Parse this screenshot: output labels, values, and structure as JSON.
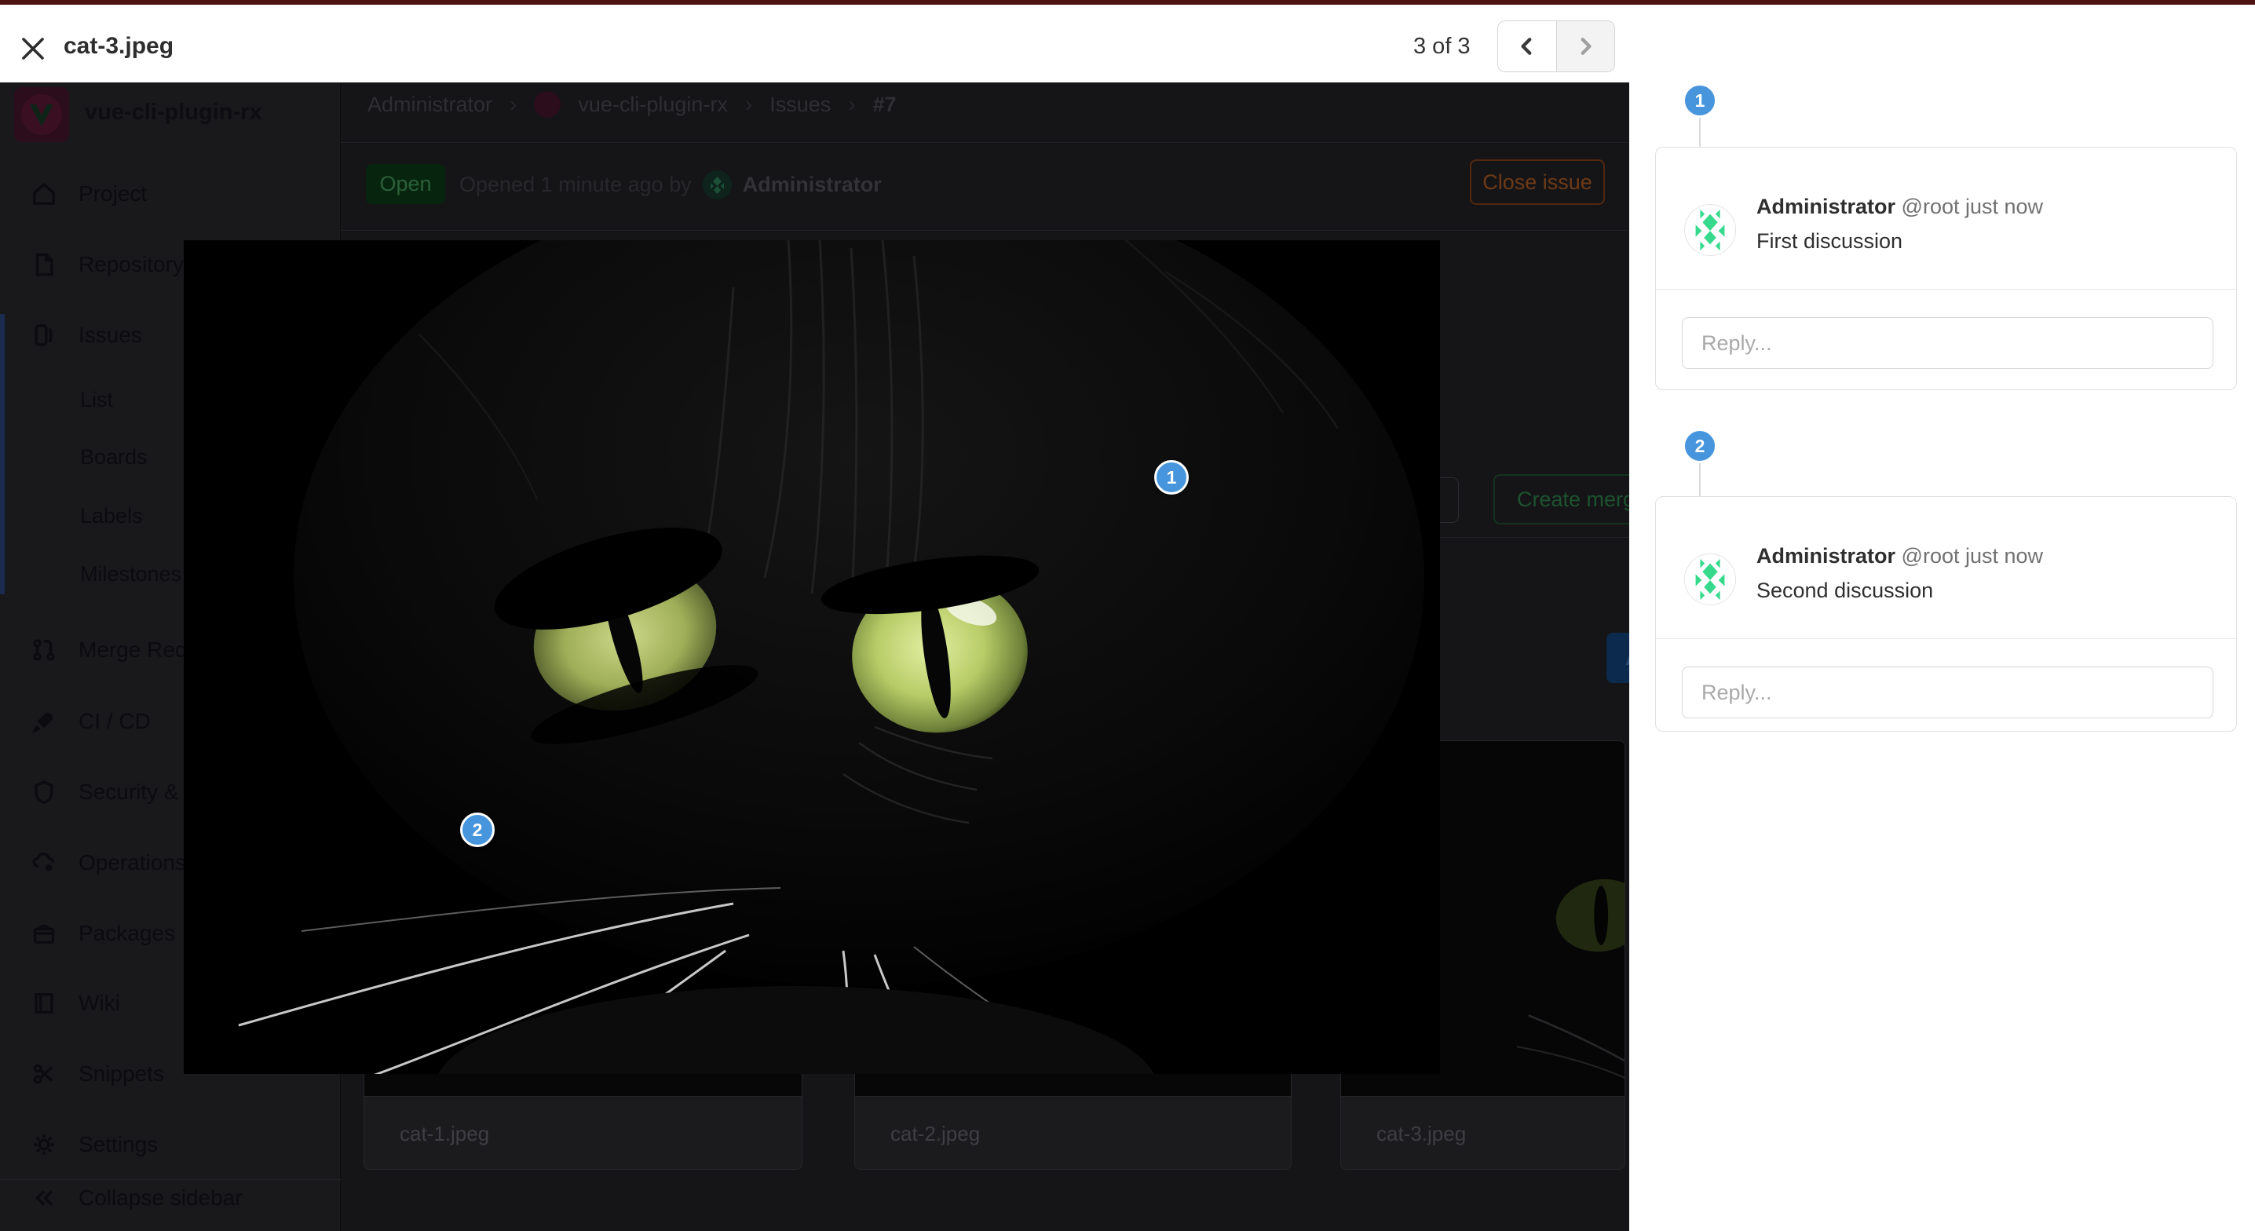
{
  "topbar": {
    "title": "cat-3.jpeg",
    "counter": "3 of 3"
  },
  "sidebar": {
    "project_name": "vue-cli-plugin-rx",
    "items": [
      {
        "icon": "home-icon",
        "label": "Project"
      },
      {
        "icon": "document-icon",
        "label": "Repository"
      },
      {
        "icon": "issues-icon",
        "label": "Issues"
      },
      {
        "icon": "",
        "label": "List"
      },
      {
        "icon": "",
        "label": "Boards"
      },
      {
        "icon": "",
        "label": "Labels"
      },
      {
        "icon": "",
        "label": "Milestones"
      },
      {
        "icon": "merge-request-icon",
        "label": "Merge Requests"
      },
      {
        "icon": "rocket-icon",
        "label": "CI / CD"
      },
      {
        "icon": "shield-icon",
        "label": "Security & Compliance"
      },
      {
        "icon": "cloud-gear-icon",
        "label": "Operations"
      },
      {
        "icon": "package-icon",
        "label": "Packages"
      },
      {
        "icon": "book-icon",
        "label": "Wiki"
      },
      {
        "icon": "scissors-icon",
        "label": "Snippets"
      },
      {
        "icon": "gear-icon",
        "label": "Settings"
      }
    ],
    "collapse_label": "Collapse sidebar"
  },
  "breadcrumb": {
    "items": [
      "Administrator",
      "vue-cli-plugin-rx",
      "Issues",
      "#7"
    ],
    "separator": "›"
  },
  "issue_header": {
    "status_badge": "Open",
    "opened_text": "Opened 1 minute ago by",
    "author": "Administrator",
    "close_button": "Close issue",
    "create_merge_button": "Create merge request",
    "comment_button": "A"
  },
  "designs": [
    {
      "filename": "cat-1.jpeg"
    },
    {
      "filename": "cat-2.jpeg"
    },
    {
      "filename": "cat-3.jpeg"
    }
  ],
  "discussions": [
    {
      "badge": "1",
      "author": "Administrator",
      "meta": "@root just now",
      "body": "First discussion",
      "reply_placeholder": "Reply..."
    },
    {
      "badge": "2",
      "author": "Administrator",
      "meta": "@root just now",
      "body": "Second discussion",
      "reply_placeholder": "Reply..."
    }
  ],
  "image_pins": [
    {
      "number": "1"
    },
    {
      "number": "2"
    }
  ],
  "colors": {
    "pin_blue": "#4795dc",
    "top_bar": "#4e1212",
    "open_badge_green": "#07240f"
  }
}
